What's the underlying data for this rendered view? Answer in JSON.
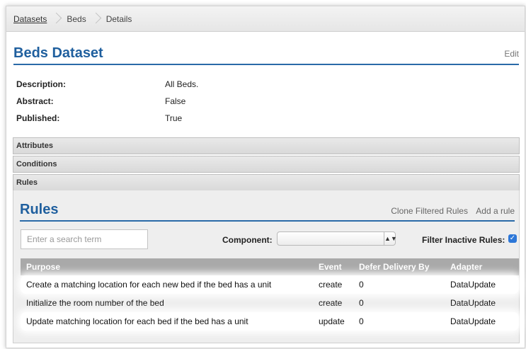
{
  "breadcrumb": {
    "items": [
      "Datasets",
      "Beds",
      "Details"
    ]
  },
  "dataset": {
    "title": "Beds Dataset",
    "edit_label": "Edit",
    "properties": [
      {
        "key": "Description:",
        "value": "All Beds."
      },
      {
        "key": "Abstract:",
        "value": "False"
      },
      {
        "key": "Published:",
        "value": "True"
      }
    ]
  },
  "sections": {
    "attributes": "Attributes",
    "conditions": "Conditions",
    "rules": "Rules"
  },
  "rules_panel": {
    "title": "Rules",
    "clone_label": "Clone Filtered Rules",
    "add_label": "Add a rule",
    "search_placeholder": "Enter a search term",
    "component_label": "Component:",
    "component_value": "",
    "filter_label": "Filter Inactive Rules:",
    "filter_checked": true,
    "columns": {
      "purpose": "Purpose",
      "event": "Event",
      "defer": "Defer Delivery By",
      "adapter": "Adapter"
    },
    "rows": [
      {
        "purpose": "Create a matching location for each new bed if the bed has a unit",
        "event": "create",
        "defer": "0",
        "adapter": "DataUpdate"
      },
      {
        "purpose": "Initialize the room number of the bed",
        "event": "create",
        "defer": "0",
        "adapter": "DataUpdate"
      },
      {
        "purpose": "Update matching location for each bed if the bed has a unit",
        "event": "update",
        "defer": "0",
        "adapter": "DataUpdate"
      }
    ]
  },
  "colors": {
    "heading": "#1f5f9e",
    "table_header": "#a9a9a9",
    "checkbox": "#2d77d8"
  }
}
